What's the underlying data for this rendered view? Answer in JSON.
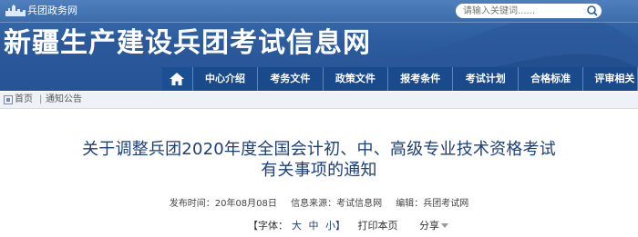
{
  "topbar": {
    "site_link": "兵团政务网",
    "search_placeholder": "请输入关键词......"
  },
  "header": {
    "site_title": "新疆生产建设兵团考试信息网"
  },
  "nav": {
    "items": [
      {
        "label": "中心介绍"
      },
      {
        "label": "考务文件"
      },
      {
        "label": "政策文件"
      },
      {
        "label": "报考条件"
      },
      {
        "label": "考试计划"
      },
      {
        "label": "合格标准"
      },
      {
        "label": "评审相关"
      }
    ]
  },
  "breadcrumb": {
    "home": "首页",
    "separator": "|",
    "current": "通知公告"
  },
  "article": {
    "title_line1": "关于调整兵团2020年度全国会计初、中、高级专业技术资格考试",
    "title_line2": "有关事项的通知",
    "publish_time": "发布时间：20年08月08日",
    "source": "信息来源：考试信息网",
    "editor": "编辑：兵团考试网",
    "font_label": "【字体：",
    "font_large": "大",
    "font_medium": "中",
    "font_small": "小】",
    "print_label": "打印本页",
    "share_label": "分享"
  },
  "colors": {
    "banner": "#2d5d9f",
    "nav": "#1a4a8c",
    "title": "#1d3f78"
  }
}
